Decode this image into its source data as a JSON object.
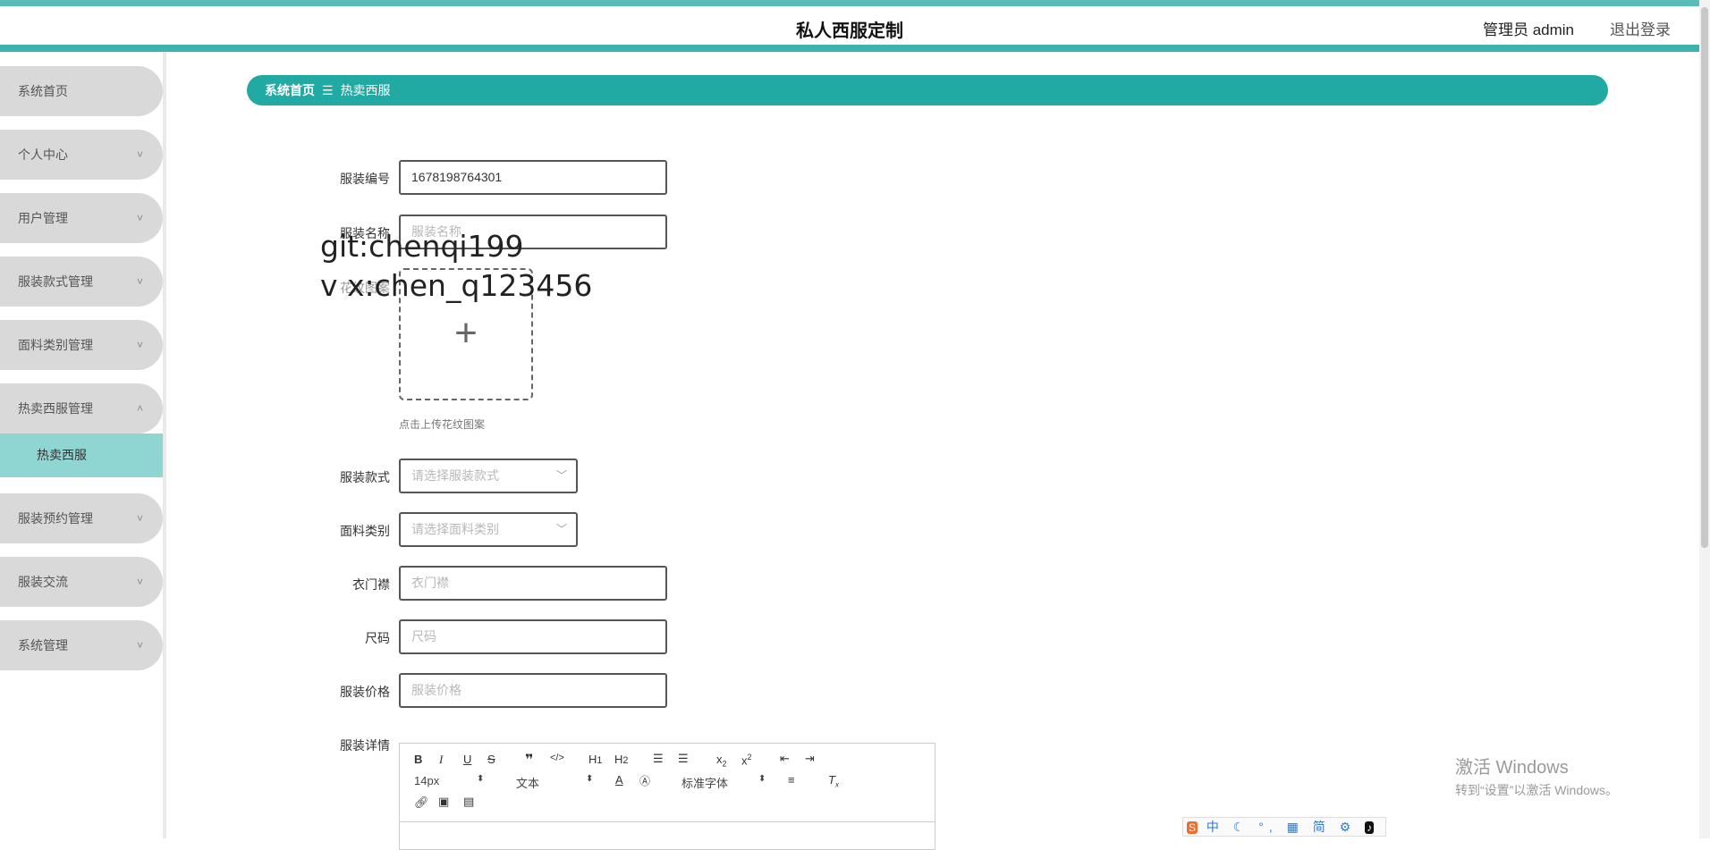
{
  "header": {
    "title": "私人西服定制",
    "user": "管理员 admin",
    "logout": "退出登录"
  },
  "sidebar": {
    "items": [
      {
        "label": "系统首页"
      },
      {
        "label": "个人中心",
        "chevron": "˅"
      },
      {
        "label": "用户管理",
        "chevron": "˅"
      },
      {
        "label": "服装款式管理",
        "chevron": "˅"
      },
      {
        "label": "面料类别管理",
        "chevron": "˅"
      },
      {
        "label": "热卖西服管理",
        "chevron": "˄"
      },
      {
        "label": "服装预约管理",
        "chevron": "˅"
      },
      {
        "label": "服装交流",
        "chevron": "˅"
      },
      {
        "label": "系统管理",
        "chevron": "˅"
      }
    ],
    "sub_item": "热卖西服"
  },
  "breadcrumb": {
    "home": "系统首页",
    "separator": "☰",
    "current": "热卖西服"
  },
  "form": {
    "code_label": "服装编号",
    "code_value": "1678198764301",
    "name_label": "服装名称",
    "name_placeholder": "服装名称",
    "image_label": "花纹图案",
    "image_hint": "点击上传花纹图案",
    "style_label": "服装款式",
    "style_placeholder": "请选择服装款式",
    "fabric_label": "面料类别",
    "fabric_placeholder": "请选择面料类别",
    "placket_label": "衣门襟",
    "placket_placeholder": "衣门襟",
    "size_label": "尺码",
    "size_placeholder": "尺码",
    "price_label": "服装价格",
    "price_placeholder": "服装价格",
    "detail_label": "服装详情"
  },
  "watermark": {
    "line1": "git:chenqi199",
    "line2": "v x:chen_q123456"
  },
  "editor": {
    "font_size": "14px",
    "text_type": "文本",
    "font_family": "标准字体"
  },
  "windows": {
    "line1": "激活 Windows",
    "line2": "转到“设置”以激活 Windows。"
  },
  "ime": {
    "logo": "S",
    "text": "中 ☾ °, ▦ 简 ⚙",
    "tiktok": "♪"
  },
  "colors": {
    "accent": "#20aaa3",
    "header_bar": "#3cb3ac",
    "sidebar_item": "#d9d9d9",
    "active_sub": "#8fd5d1"
  }
}
